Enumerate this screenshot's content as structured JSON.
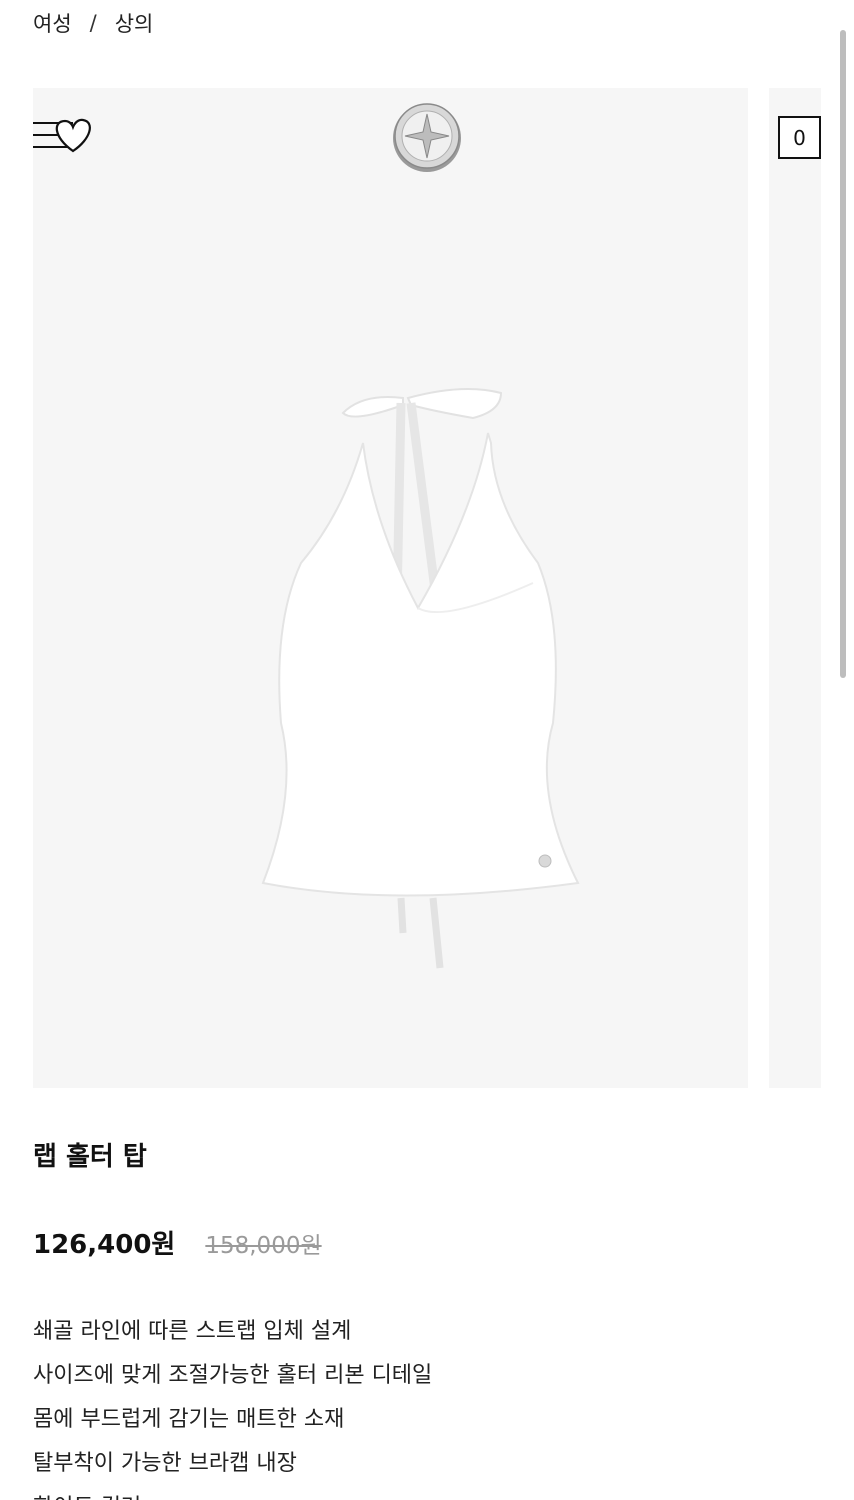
{
  "breadcrumb": {
    "items": [
      "여성",
      "상의"
    ],
    "separator": "/"
  },
  "header": {
    "menu_icon": "hamburger-menu-icon",
    "wishlist_icon": "heart-icon",
    "logo": "brand-coin-logo",
    "cart_count": "0"
  },
  "product": {
    "title": "랩 홀터 탑",
    "sale_price": "126,400원",
    "original_price": "158,000원",
    "description": [
      "쇄골 라인에 따른 스트랩 입체 설계",
      "사이즈에 맞게 조절가능한 홀터 리본 디테일",
      "몸에 부드럽게 감기는 매트한 소재",
      "탈부착이 가능한 브라캡 내장",
      "화이트 컬러"
    ]
  },
  "colors": {
    "gallery_bg": "#f6f6f6",
    "text": "#111111",
    "original_price": "#9a9a9a"
  }
}
